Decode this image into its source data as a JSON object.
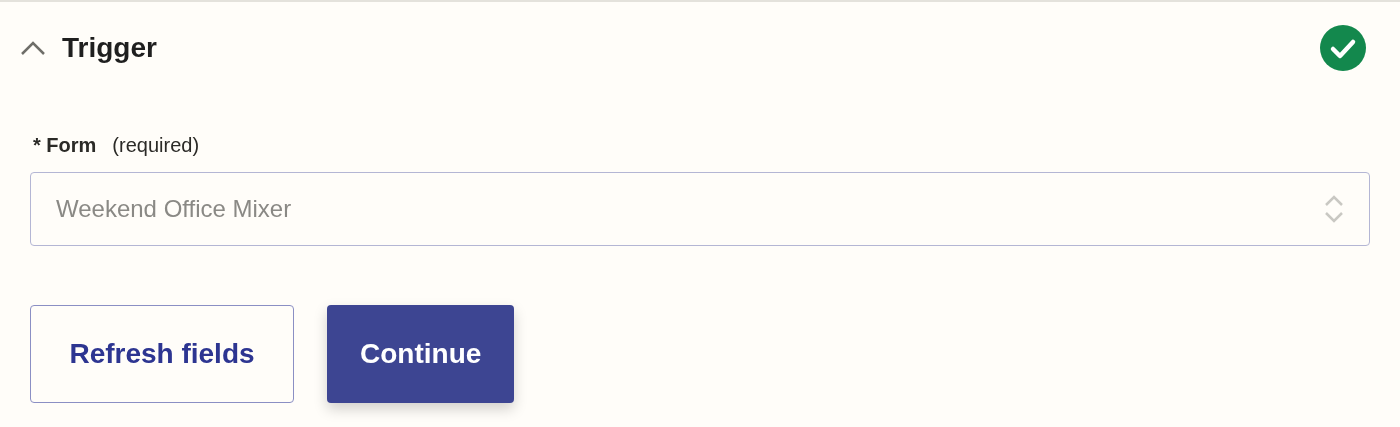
{
  "section": {
    "title": "Trigger",
    "expanded": true,
    "complete": true
  },
  "field": {
    "label": "Form",
    "required_mark": "*",
    "note": "(required)",
    "value": "Weekend Office Mixer"
  },
  "buttons": [
    {
      "label": "Refresh fields",
      "kind": "secondary"
    },
    {
      "label": "Continue",
      "kind": "primary"
    }
  ]
}
